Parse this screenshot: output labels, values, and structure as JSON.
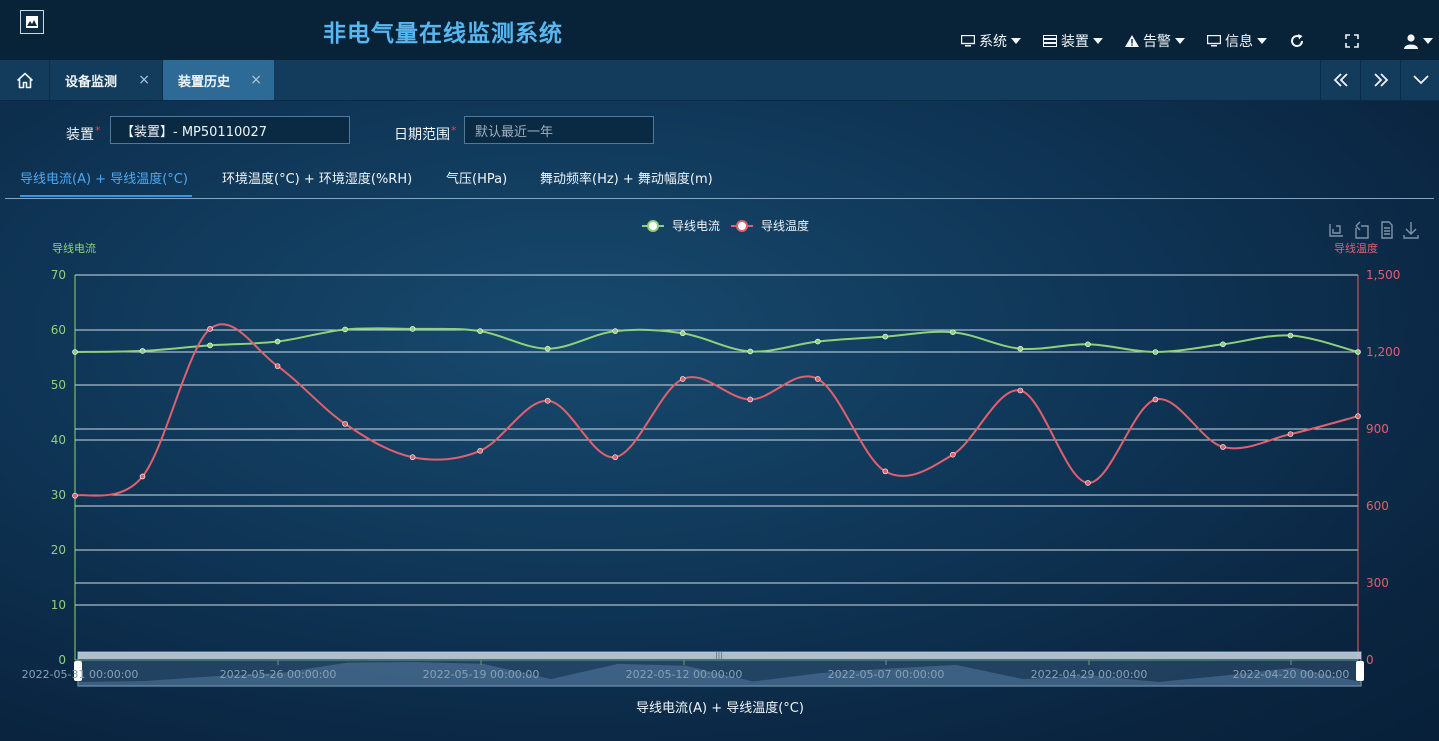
{
  "header": {
    "title": "非电气量在线监测系统",
    "menu": [
      {
        "label": "系统",
        "icon": "monitor-icon"
      },
      {
        "label": "装置",
        "icon": "server-icon"
      },
      {
        "label": "告警",
        "icon": "warning-icon"
      },
      {
        "label": "信息",
        "icon": "monitor-icon"
      }
    ]
  },
  "tabs": {
    "items": [
      {
        "label": "设备监测"
      },
      {
        "label": "装置历史"
      }
    ],
    "close_symbol": "×"
  },
  "form": {
    "device_label": "装置",
    "device_value": "【装置】- MP50110027",
    "date_label": "日期范围",
    "date_placeholder": "默认最近一年",
    "required_mark": "*"
  },
  "chart_tabs": [
    "导线电流(A) + 导线温度(°C)",
    "环境温度(°C) + 环境湿度(%RH)",
    "气压(HPa)",
    "舞动频率(Hz) + 舞动幅度(m)"
  ],
  "chart_data": {
    "type": "line",
    "title": "导线电流(A) + 导线温度(°C)",
    "legend": [
      "导线电流",
      "导线温度"
    ],
    "legend_position": "top-center",
    "left_axis": {
      "name": "导线电流",
      "min": 0,
      "max": 70,
      "ticks": [
        0,
        10,
        20,
        30,
        40,
        50,
        60,
        70
      ],
      "color": "#8fd17a"
    },
    "right_axis": {
      "name": "导线温度",
      "min": 0,
      "max": 1500,
      "ticks": [
        0,
        300,
        600,
        900,
        1200,
        1500
      ],
      "tick_labels": [
        "0",
        "300",
        "600",
        "900",
        "1,200",
        "1,500"
      ],
      "color": "#e0606e"
    },
    "x_tick_labels": [
      "2022-05-31 00:00:00",
      "2022-05-26 00:00:00",
      "2022-05-19 00:00:00",
      "2022-05-12 00:00:00",
      "2022-05-07 00:00:00",
      "2022-04-29 00:00:00",
      "2022-04-20 00:00:00"
    ],
    "grid": true,
    "series": [
      {
        "name": "导线电流",
        "color": "#8fd17a",
        "values": [
          56,
          56.2,
          57.2,
          57.9,
          60.1,
          60.2,
          59.8,
          56.6,
          59.8,
          59.4,
          56.1,
          57.9,
          58.8,
          59.6,
          56.6,
          57.4,
          56,
          57.4,
          59,
          56
        ]
      },
      {
        "name": "导线温度",
        "color": "#e0606e",
        "values": [
          640,
          715,
          1290,
          1145,
          920,
          790,
          815,
          1010,
          790,
          1095,
          1015,
          1095,
          735,
          800,
          1050,
          690,
          1015,
          830,
          880,
          950
        ]
      }
    ]
  }
}
